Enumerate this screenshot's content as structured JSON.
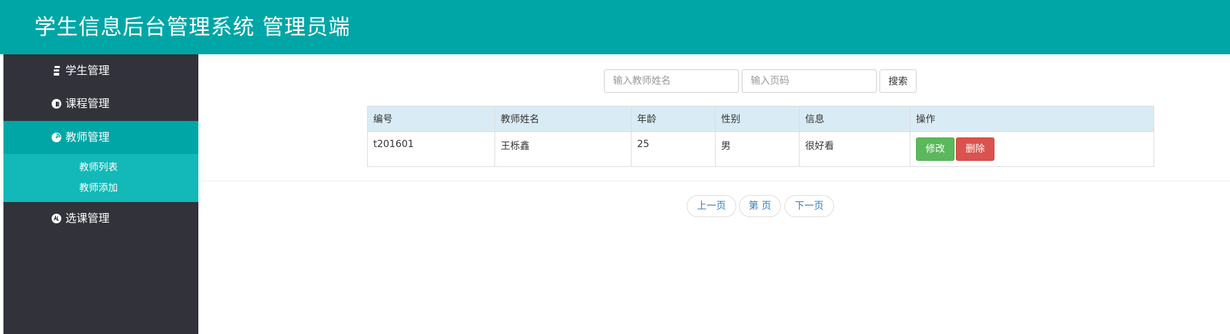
{
  "header": {
    "title": "学生信息后台管理系统 管理员端"
  },
  "sidebar": {
    "items": [
      {
        "label": "学生管理"
      },
      {
        "label": "课程管理"
      },
      {
        "label": "教师管理"
      },
      {
        "label": "选课管理"
      }
    ],
    "submenu": [
      {
        "label": "教师列表"
      },
      {
        "label": "教师添加"
      }
    ]
  },
  "search": {
    "name_placeholder": "输入教师姓名",
    "page_placeholder": "输入页码",
    "button_label": "搜索"
  },
  "table": {
    "columns": [
      "编号",
      "教师姓名",
      "年龄",
      "性别",
      "信息",
      "操作"
    ],
    "rows": [
      {
        "id": "t201601",
        "name": "王栎鑫",
        "age": "25",
        "gender": "男",
        "info": "很好看",
        "edit_label": "修改",
        "delete_label": "删除"
      }
    ]
  },
  "pagination": {
    "prev_label": "上一页",
    "page_label": "第 页",
    "next_label": "下一页"
  },
  "colors": {
    "header": "#00a6a6",
    "sidebar": "#32323b",
    "active": "#00a6a6",
    "submenu": "#13b8b8",
    "edit": "#5cb85c",
    "delete": "#d9534f",
    "table_header": "#d9ebf5"
  }
}
